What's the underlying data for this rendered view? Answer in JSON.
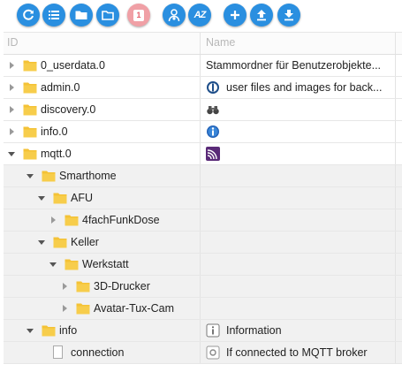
{
  "toolbar": {
    "buttons": [
      {
        "icon": "refresh-icon"
      },
      {
        "icon": "list-icon"
      },
      {
        "icon": "folder-icon"
      },
      {
        "icon": "folder-outline-icon"
      },
      {
        "icon": "number-badge-icon",
        "badge": "1"
      },
      {
        "icon": "user-settings-icon"
      },
      {
        "icon": "sort-az-icon",
        "text": "AZ"
      },
      {
        "icon": "add-icon"
      },
      {
        "icon": "upload-icon"
      },
      {
        "icon": "download-icon"
      }
    ]
  },
  "table": {
    "columns": [
      "ID",
      "Name"
    ],
    "rows": [
      {
        "level": 0,
        "expander": "right",
        "type": "folder",
        "id": "0_userdata.0",
        "name": "Stammordner für Benutzerobjekte...",
        "name_icon": ""
      },
      {
        "level": 0,
        "expander": "right",
        "type": "folder",
        "id": "admin.0",
        "name": "user files and images for back...",
        "name_icon": "admin-logo-icon"
      },
      {
        "level": 0,
        "expander": "right",
        "type": "folder",
        "id": "discovery.0",
        "name": "",
        "name_icon": "binoculars-icon"
      },
      {
        "level": 0,
        "expander": "right",
        "type": "folder",
        "id": "info.0",
        "name": "",
        "name_icon": "info-logo-icon"
      },
      {
        "level": 0,
        "expander": "down",
        "type": "folder",
        "id": "mqtt.0",
        "name": "",
        "name_icon": "mqtt-logo-icon"
      },
      {
        "level": 1,
        "expander": "down",
        "type": "folder",
        "id": "Smarthome",
        "name": "",
        "name_icon": ""
      },
      {
        "level": 2,
        "expander": "down",
        "type": "folder",
        "id": "AFU",
        "name": "",
        "name_icon": ""
      },
      {
        "level": 3,
        "expander": "right",
        "type": "folder",
        "id": "4fachFunkDose",
        "name": "",
        "name_icon": ""
      },
      {
        "level": 2,
        "expander": "down",
        "type": "folder",
        "id": "Keller",
        "name": "",
        "name_icon": ""
      },
      {
        "level": 3,
        "expander": "down",
        "type": "folder",
        "id": "Werkstatt",
        "name": "",
        "name_icon": ""
      },
      {
        "level": 4,
        "expander": "right",
        "type": "folder",
        "id": "3D-Drucker",
        "name": "",
        "name_icon": ""
      },
      {
        "level": 4,
        "expander": "right",
        "type": "folder",
        "id": "Avatar-Tux-Cam",
        "name": "",
        "name_icon": ""
      },
      {
        "level": 1,
        "expander": "down",
        "type": "folder",
        "id": "info",
        "name": "Information",
        "name_icon": "info-box-icon"
      },
      {
        "level": 2,
        "expander": "none",
        "type": "file",
        "id": "connection",
        "name": "If connected to MQTT broker",
        "name_icon": "state-icon"
      }
    ]
  },
  "colors": {
    "accent": "#2a8fe0",
    "folder": "#f4c236",
    "badge": "#f0a0a6"
  }
}
